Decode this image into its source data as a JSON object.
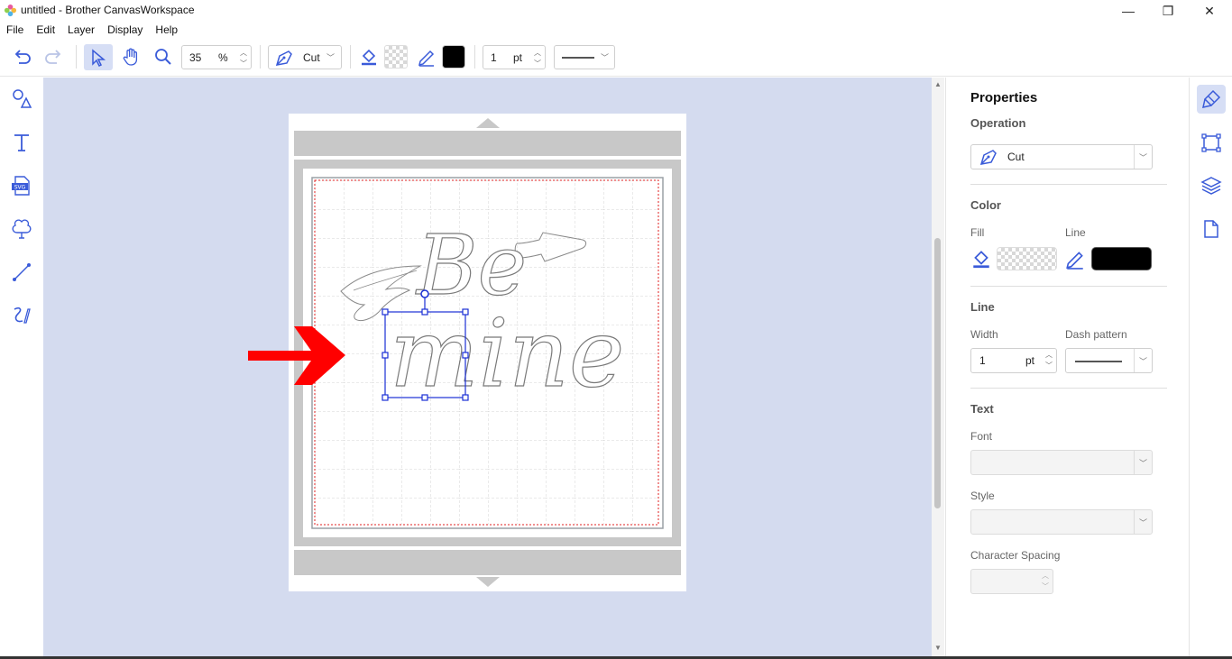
{
  "window": {
    "title": "untitled - Brother CanvasWorkspace",
    "minimize": "—",
    "restore": "❐",
    "close": "✕"
  },
  "menu": [
    "File",
    "Edit",
    "Layer",
    "Display",
    "Help"
  ],
  "toolbar": {
    "zoom_value": "35",
    "zoom_unit": "%",
    "operation_label": "Cut",
    "line_width": "1",
    "line_unit": "pt",
    "line_color": "#000000"
  },
  "left_tools": [
    "shapes-icon",
    "text-icon",
    "svg-import-icon",
    "shape-library-icon",
    "line-tool-icon",
    "freehand-tool-icon"
  ],
  "canvas": {
    "background": "#d4dbef",
    "text_line1": "Be",
    "text_line2": "mine",
    "arrow_color": "#ff0000",
    "selection_color": "#1a2fd6"
  },
  "properties": {
    "title": "Properties",
    "operation_heading": "Operation",
    "operation_value": "Cut",
    "color_heading": "Color",
    "fill_label": "Fill",
    "line_label": "Line",
    "line_color": "#000000",
    "line_heading": "Line",
    "width_label": "Width",
    "width_value": "1",
    "width_unit": "pt",
    "dash_label": "Dash pattern",
    "text_heading": "Text",
    "font_label": "Font",
    "style_label": "Style",
    "spacing_label": "Character Spacing"
  },
  "right_strip": [
    "paintbrush-icon",
    "transform-icon",
    "layers-icon",
    "page-icon"
  ]
}
